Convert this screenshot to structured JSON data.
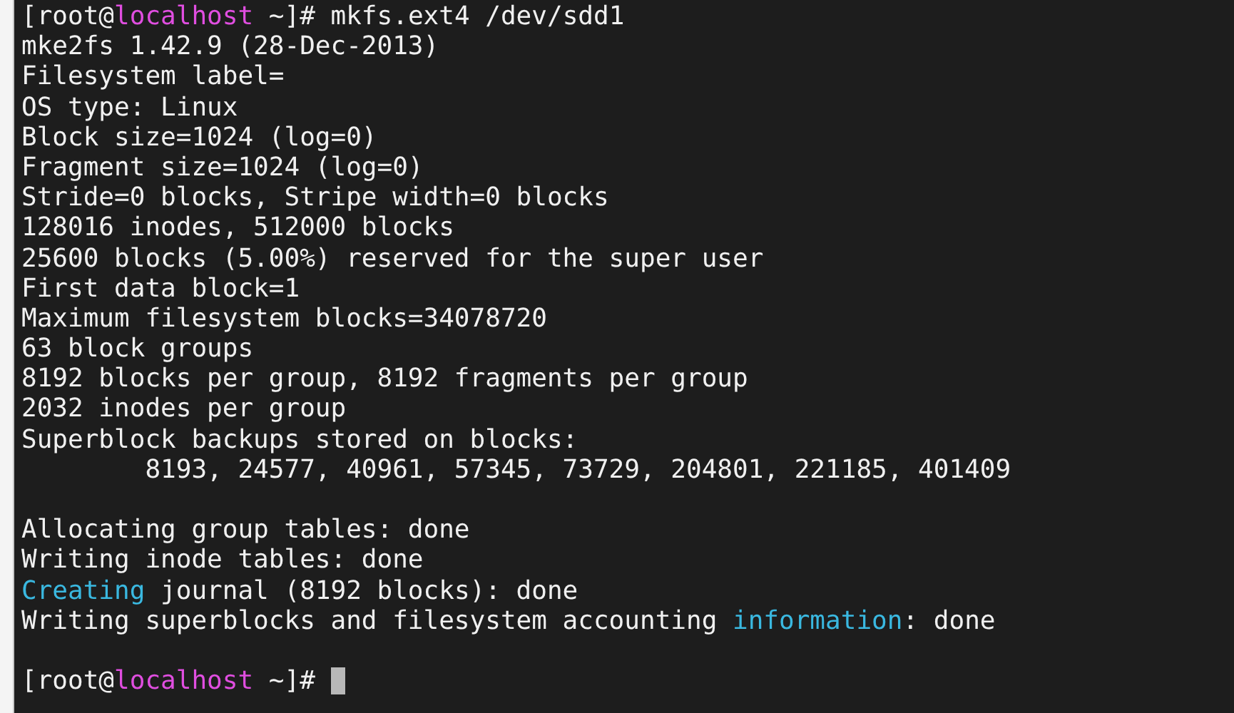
{
  "terminal": {
    "blocks": [
      {
        "lines": [
          {
            "segments": [
              {
                "kind": "plain",
                "text": "[root@"
              },
              {
                "kind": "host",
                "text": "localhost"
              },
              {
                "kind": "plain",
                "text": " ~]# mkfs.ext4 /dev/sdd1"
              }
            ]
          },
          {
            "segments": [
              {
                "kind": "plain",
                "text": "mke2fs 1.42.9 (28-Dec-2013)"
              }
            ]
          },
          {
            "segments": [
              {
                "kind": "plain",
                "text": "Filesystem label="
              }
            ]
          },
          {
            "segments": [
              {
                "kind": "plain",
                "text": "OS type: Linux"
              }
            ]
          },
          {
            "segments": [
              {
                "kind": "plain",
                "text": "Block size=1024 (log=0)"
              }
            ]
          },
          {
            "segments": [
              {
                "kind": "plain",
                "text": "Fragment size=1024 (log=0)"
              }
            ]
          },
          {
            "segments": [
              {
                "kind": "plain",
                "text": "Stride=0 blocks, Stripe width=0 blocks"
              }
            ]
          },
          {
            "segments": [
              {
                "kind": "plain",
                "text": "128016 inodes, 512000 blocks"
              }
            ]
          },
          {
            "segments": [
              {
                "kind": "plain",
                "text": "25600 blocks (5.00%) reserved for the super user"
              }
            ]
          },
          {
            "segments": [
              {
                "kind": "plain",
                "text": "First data block=1"
              }
            ]
          },
          {
            "segments": [
              {
                "kind": "plain",
                "text": "Maximum filesystem blocks=34078720"
              }
            ]
          },
          {
            "segments": [
              {
                "kind": "plain",
                "text": "63 block groups"
              }
            ]
          },
          {
            "segments": [
              {
                "kind": "plain",
                "text": "8192 blocks per group, 8192 fragments per group"
              }
            ]
          },
          {
            "segments": [
              {
                "kind": "plain",
                "text": "2032 inodes per group"
              }
            ]
          },
          {
            "segments": [
              {
                "kind": "plain",
                "text": "Superblock backups stored on blocks:"
              }
            ]
          },
          {
            "segments": [
              {
                "kind": "plain",
                "text": "        8193, 24577, 40961, 57345, 73729, 204801, 221185, 401409"
              }
            ]
          }
        ]
      },
      {
        "lines": [
          {
            "segments": [
              {
                "kind": "plain",
                "text": "Allocating group tables: done"
              }
            ]
          },
          {
            "segments": [
              {
                "kind": "plain",
                "text": "Writing inode tables: done"
              }
            ]
          },
          {
            "segments": [
              {
                "kind": "keyword",
                "text": "Creating"
              },
              {
                "kind": "plain",
                "text": " journal (8192 blocks): done"
              }
            ]
          },
          {
            "segments": [
              {
                "kind": "plain",
                "text": "Writing superblocks and filesystem accounting "
              },
              {
                "kind": "keyword",
                "text": "information"
              },
              {
                "kind": "plain",
                "text": ": done"
              }
            ]
          }
        ]
      },
      {
        "lines": [
          {
            "segments": [
              {
                "kind": "plain",
                "text": "[root@"
              },
              {
                "kind": "host",
                "text": "localhost"
              },
              {
                "kind": "plain",
                "text": " ~]# "
              }
            ],
            "cursor": true
          }
        ]
      }
    ]
  }
}
